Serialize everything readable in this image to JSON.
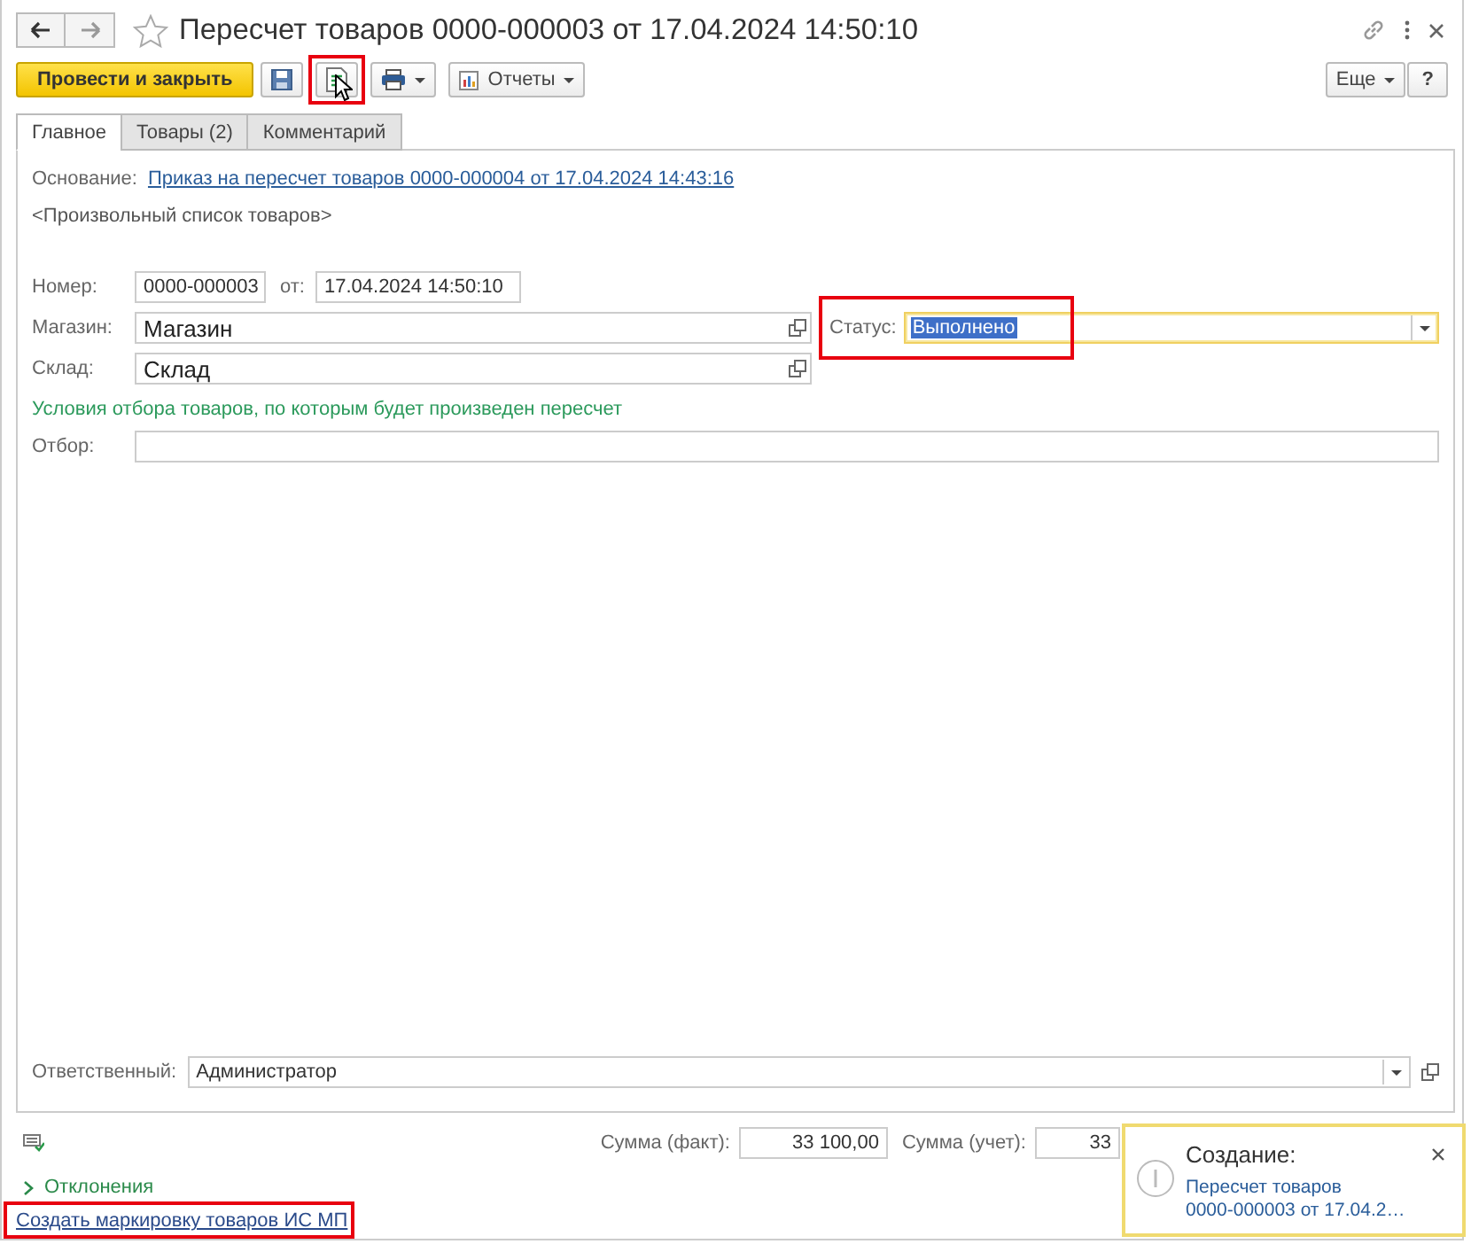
{
  "window": {
    "title": "Пересчет товаров 0000-000003 от 17.04.2024 14:50:10"
  },
  "toolbar": {
    "primary_button": "Провести и закрыть",
    "buttons": [
      {
        "kind": "save",
        "highlighted": false
      },
      {
        "kind": "create-based",
        "highlighted": true
      },
      {
        "kind": "print",
        "highlighted": false
      },
      {
        "kind": "reports",
        "label": "Отчеты",
        "highlighted": false
      }
    ],
    "more_button": "Еще",
    "help_button": "?"
  },
  "tabs": [
    {
      "label": "Главное",
      "selected": true
    },
    {
      "label": "Товары (2)",
      "selected": false
    },
    {
      "label": "Комментарий",
      "selected": false
    }
  ],
  "basis": {
    "label": "Основание:",
    "link": "Приказ на пересчет товаров 0000-000004 от 17.04.2024 14:43:16"
  },
  "list_note": "<Произвольный список товаров>",
  "number": {
    "label": "Номер:",
    "value": "0000-000003"
  },
  "date": {
    "label": "от:",
    "value": "17.04.2024 14:50:10"
  },
  "store": {
    "label": "Магазин:",
    "value": "Магазин"
  },
  "status": {
    "label": "Статус:",
    "value": "Выполнено",
    "highlighted": true
  },
  "warehouse": {
    "label": "Склад:",
    "value": "Склад"
  },
  "filter_heading": "Условия отбора товаров, по которым будет произведен пересчет",
  "filter": {
    "label": "Отбор:"
  },
  "responsible": {
    "label": "Ответственный:",
    "value": "Администратор"
  },
  "totals": [
    {
      "label": "Сумма (факт):",
      "value": "33 100,00"
    },
    {
      "label": "Сумма (учет):",
      "value": "33"
    }
  ],
  "deviations": {
    "label": "Отклонения",
    "expanded": false
  },
  "bottom_link": {
    "text": "Создать маркировку товаров ИС МП",
    "highlighted": true
  },
  "notification": {
    "title": "Создание:",
    "link": "Пересчет товаров 0000-000003 от 17.04.2…"
  }
}
